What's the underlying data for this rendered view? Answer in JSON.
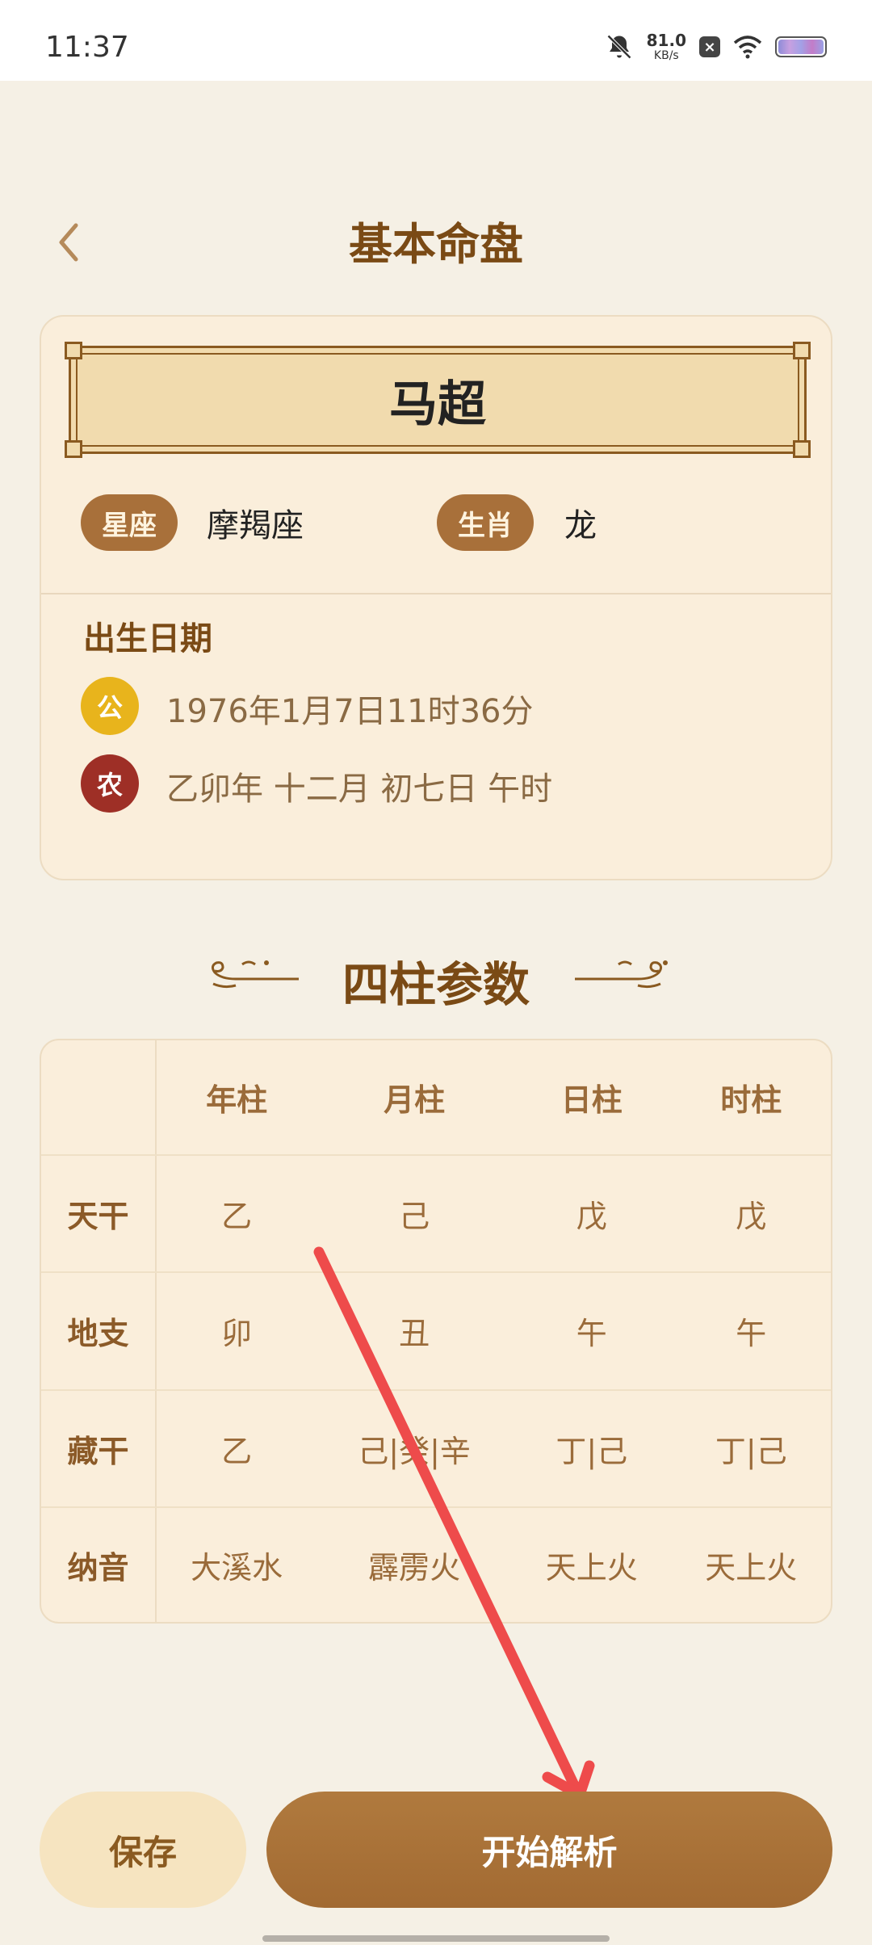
{
  "status_bar": {
    "time": "11:37",
    "net_speed_value": "81.0",
    "net_speed_unit": "KB/s",
    "x_badge": "×",
    "icons": [
      "mute-icon",
      "x-notification-icon",
      "wifi-icon",
      "battery-icon"
    ]
  },
  "header": {
    "back_icon": "chevron-left-icon",
    "title": "基本命盘"
  },
  "profile": {
    "name": "马超",
    "zodiac_label": "星座",
    "zodiac_value": "摩羯座",
    "shengxiao_label": "生肖",
    "shengxiao_value": "龙"
  },
  "birth": {
    "label": "出生日期",
    "solar_badge": "公",
    "solar_date": "1976年1月7日11时36分",
    "lunar_badge": "农",
    "lunar_date": "乙卯年 十二月 初七日 午时"
  },
  "pillars": {
    "title": "四柱参数",
    "columns": [
      "年柱",
      "月柱",
      "日柱",
      "时柱"
    ],
    "rows": [
      {
        "label": "天干",
        "values": [
          "乙",
          "己",
          "戊",
          "戊"
        ]
      },
      {
        "label": "地支",
        "values": [
          "卯",
          "丑",
          "午",
          "午"
        ]
      },
      {
        "label": "藏干",
        "values": [
          "乙",
          "己|癸|辛",
          "丁|己",
          "丁|己"
        ]
      },
      {
        "label": "纳音",
        "values": [
          "大溪水",
          "霹雳火",
          "天上火",
          "天上火"
        ]
      }
    ]
  },
  "actions": {
    "save_label": "保存",
    "start_label": "开始解析"
  },
  "colors": {
    "background": "#f5f0e5",
    "accent_brown": "#a8703a",
    "title_brown": "#7a4a15",
    "solar_badge": "#e8b41c",
    "lunar_badge": "#9e2f26",
    "annotation_arrow": "#ee4b4b"
  }
}
